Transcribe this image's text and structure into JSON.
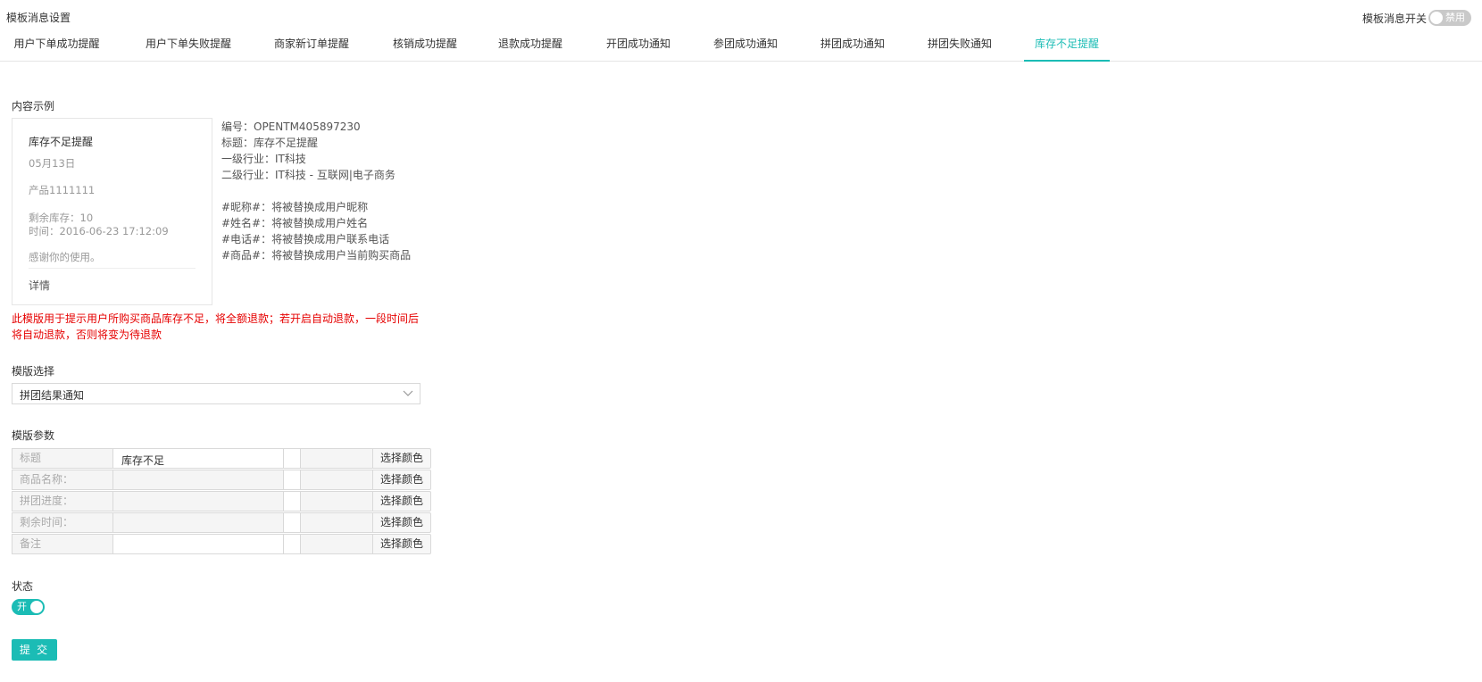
{
  "header": {
    "title": "模板消息设置",
    "master_switch_label": "模板消息开关",
    "master_switch_state": "禁用"
  },
  "tabs": [
    {
      "label": "用户下单成功提醒"
    },
    {
      "label": "用户下单失败提醒"
    },
    {
      "label": "商家新订单提醒"
    },
    {
      "label": "核销成功提醒"
    },
    {
      "label": "退款成功提醒"
    },
    {
      "label": "开团成功通知"
    },
    {
      "label": "参团成功通知"
    },
    {
      "label": "拼团成功通知"
    },
    {
      "label": "拼团失败通知"
    },
    {
      "label": "库存不足提醒",
      "active": true
    }
  ],
  "preview": {
    "section_label": "内容示例",
    "card": {
      "title": "库存不足提醒",
      "date": "05月13日",
      "product": "产品1111111",
      "stock": "剩余库存：10",
      "time": "时间：2016-06-23 17:12:09",
      "thanks": "感谢你的使用。",
      "detail": "详情"
    },
    "info": {
      "code": "编号：OPENTM405897230",
      "title": "标题：库存不足提醒",
      "industry1": "一级行业：IT科技",
      "industry2": "二级行业：IT科技 - 互联网|电子商务",
      "var_nickname": "#昵称#：将被替换成用户昵称",
      "var_name": "#姓名#：将被替换成用户姓名",
      "var_phone": "#电话#：将被替换成用户联系电话",
      "var_goods": "#商品#：将被替换成用户当前购买商品"
    },
    "warning_line1": "此模版用于提示用户所购买商品库存不足，将全额退款；若开启自动退款，一段时间后",
    "warning_line2": "将自动退款，否则将变为待退款"
  },
  "template_select": {
    "section_label": "模版选择",
    "value": "拼团结果通知"
  },
  "params": {
    "section_label": "模版参数",
    "rows": [
      {
        "label": "标题",
        "value": "库存不足",
        "button": "选择颜色"
      },
      {
        "label": "商品名称：",
        "value": "",
        "button": "选择颜色"
      },
      {
        "label": "拼团进度：",
        "value": "",
        "button": "选择颜色"
      },
      {
        "label": "剩余时间：",
        "value": "",
        "button": "选择颜色"
      },
      {
        "label": "备注",
        "value": "",
        "button": "选择颜色"
      }
    ]
  },
  "status": {
    "section_label": "状态",
    "toggle_text": "开"
  },
  "submit_label": "提 交",
  "colors": {
    "accent": "#1bbcb5",
    "warning": "#e60000"
  }
}
